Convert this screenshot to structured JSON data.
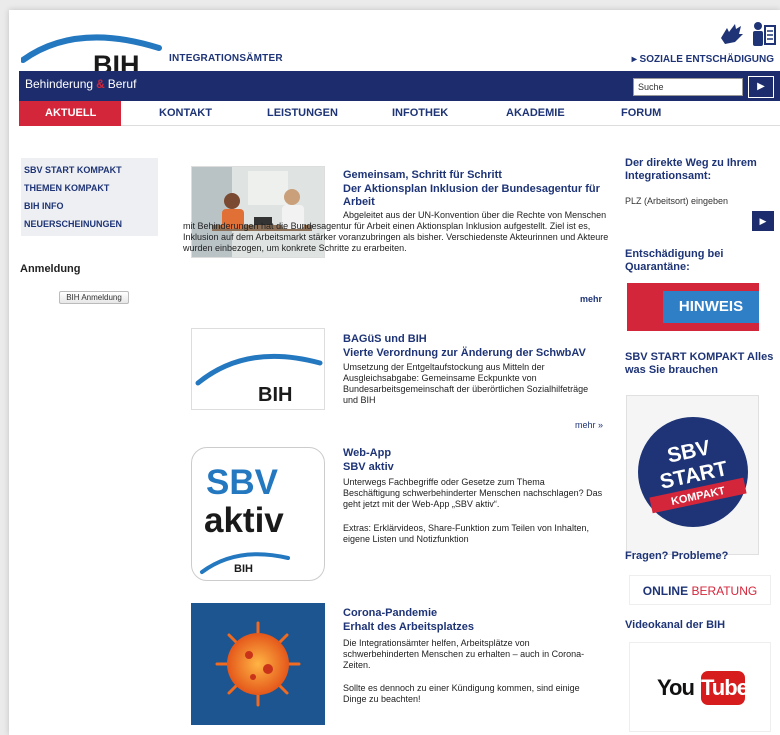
{
  "header": {
    "logo_text": "BIH",
    "tagline": "INTEGRATIONSÄMTER",
    "soziale_link": "▸ SOZIALE ENTSCHÄDIGUNG"
  },
  "bluebar": {
    "title_part1": "Behinderung",
    "title_amp": "&",
    "title_part2": "Beruf",
    "search_value": "Suche",
    "search_btn": "▶"
  },
  "nav": {
    "items": [
      "AKTUELL",
      "KONTAKT",
      "LEISTUNGEN",
      "INFOTHEK",
      "AKADEMIE",
      "FORUM"
    ]
  },
  "sidebar": {
    "items": [
      "SBV START KOMPAKT",
      "THEMEN KOMPAKT",
      "BIH INFO",
      "NEUERSCHEINUNGEN"
    ],
    "login_heading": "Anmeldung",
    "login_button": "BIH Anmeldung"
  },
  "articles": [
    {
      "kicker": "Gemeinsam, Schritt für Schritt",
      "title": "Der Aktionsplan Inklusion der Bundesagentur für Arbeit",
      "text": "Abgeleitet aus der UN-Konvention über die Rechte von Menschen mit Behinderungen hat die Bundesagentur für Arbeit einen Aktionsplan Inklusion aufgestellt. Ziel ist es, Inklusion auf dem Arbeitsmarkt stärker voranzubringen als bisher. Verschiedenste Akteurinnen und Akteure wurden einbezogen, um konkrete Schritte zu erarbeiten.",
      "more": "mehr"
    },
    {
      "kicker": "BAGüS und BIH",
      "title": "Vierte Verordnung zur Änderung der SchwbAV",
      "text": "Umsetzung der Entgeltaufstockung aus Mitteln der Ausgleichsabgabe: Gemeinsame Eckpunkte von Bundesarbeitsgemeinschaft der überörtlichen Sozialhilfeträge und BIH",
      "more": "mehr »",
      "logo_text": "BIH"
    },
    {
      "kicker": "Web-App",
      "title": "SBV aktiv",
      "text": "Unterwegs Fachbegriffe oder Gesetze zum Thema Beschäftigung schwerbehinderter Menschen nachschlagen? Das geht jetzt mit der Web-App „SBV aktiv“.",
      "text2": "Extras: Erklärvideos, Share-Funktion zum Teilen von Inhalten, eigene Listen und Notizfunktion",
      "app_line1": "SBV",
      "app_line2": "aktiv",
      "app_logo": "BIH"
    },
    {
      "kicker": "Corona-Pandemie",
      "title": "Erhalt des Arbeitsplatzes",
      "text": "Die Integrationsämter helfen, Arbeitsplätze von schwerbehinderten Menschen zu erhalten – auch in Corona-Zeiten.",
      "text2": "Sollte es dennoch zu einer Kündigung kommen, sind einige Dinge zu beachten!"
    }
  ],
  "right": {
    "weg_heading": "Der direkte Weg zu Ihrem Integrationsamt:",
    "plz_placeholder": "PLZ (Arbeitsort) eingeben",
    "plz_btn": "▶",
    "quarantaene_heading": "Entschädigung bei Quarantäne:",
    "hinweis": "HINWEIS",
    "sbv_heading": "SBV START KOMPAKT Alles was Sie brauchen",
    "sbv_badge_line1": "SBV",
    "sbv_badge_line2": "START",
    "sbv_badge_line3": "KOMPAKT",
    "fragen_heading": "Fragen? Probleme?",
    "online_bold": "ONLINE",
    "online_rest": " BERATUNG",
    "video_heading": "Videokanal der BIH",
    "yt_you": "You",
    "yt_tube": "Tube"
  },
  "colors": {
    "brand_blue": "#1c2c6c",
    "accent_red": "#d4263b",
    "logo_blue": "#2478c0"
  }
}
